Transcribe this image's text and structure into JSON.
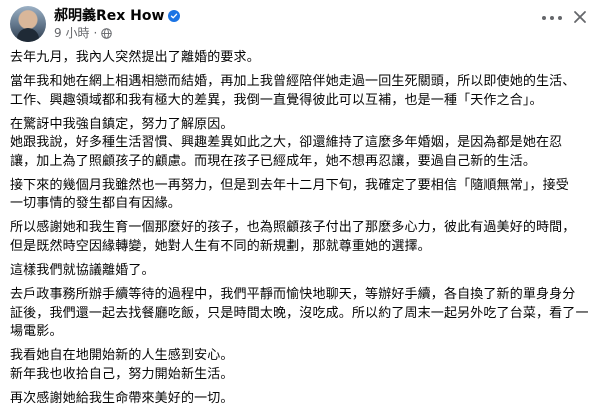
{
  "post": {
    "author": "郝明義Rex How",
    "time": "9 小時",
    "time_sep": "·",
    "paragraphs": [
      "去年九月，我內人突然提出了離婚的要求。",
      "當年我和她在網上相遇相戀而結婚，再加上我曾經陪伴她走過一回生死關頭，所以即使她的生活、\n工作、興趣領域都和我有極大的差異，我倒一直覺得彼此可以互補，也是一種「天作之合」。",
      "在驚訝中我強自鎮定，努力了解原因。\n她跟我說，好多種生活習慣、興趣差異如此之大，卻還維持了這麼多年婚姻，是因為都是她在忍\n讓，加上為了照顧孩子的顧慮。而現在孩子已經成年，她不想再忍讓，要過自己新的生活。",
      "接下來的幾個月我雖然也一再努力，但是到去年十二月下旬，我確定了要相信「隨順無常」，接受\n一切事情的發生都自有因緣。",
      "所以感謝她和我生育一個那麼好的孩子，也為照顧孩子付出了那麼多心力，彼此有過美好的時間，\n但是既然時空因緣轉變，她對人生有不同的新規劃，那就尊重她的選擇。",
      "這樣我們就協議離婚了。",
      "去戶政事務所辦手續等待的過程中，我們平靜而愉快地聊天，等辦好手續，各自換了新的單身身分\n証後，我們還一起去找餐廳吃飯，只是時間太晚，沒吃成。所以約了周末一起另外吃了台菜，看了一\n場電影。",
      "我看她自在地開始新的人生感到安心。\n新年我也收拾自己，努力開始新生活。",
      "再次感謝她給我生命帶來美好的一切。"
    ]
  },
  "colors": {
    "verified": "#1b74e4",
    "meta_text": "#65676b",
    "text": "#050505"
  },
  "icons": {
    "verified": "verified-badge-icon",
    "privacy": "globe-icon",
    "more": "more-options-icon",
    "close": "close-icon"
  }
}
